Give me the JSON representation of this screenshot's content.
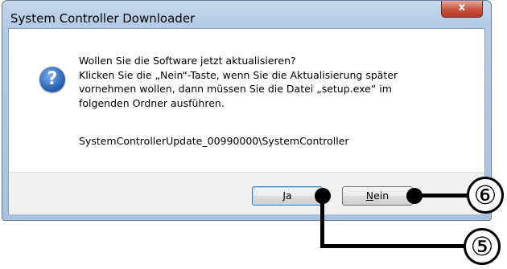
{
  "window": {
    "title": "System Controller Downloader",
    "close_label": "x"
  },
  "dialog": {
    "icon": "question-icon",
    "icon_glyph": "?",
    "message_lines": [
      "Wollen Sie die Software jetzt aktualisieren?",
      "Klicken  Sie die „Nein“-Taste, wenn Sie die Aktualisierung später",
      "vornehmen wollen, dann müssen Sie die Datei „setup.exe“ im",
      "folgenden Ordner ausführen."
    ],
    "path": "SystemControllerUpdate_00990000\\SystemController"
  },
  "buttons": {
    "ja": "Ja",
    "nein_underlined": "N",
    "nein_rest": "ein"
  },
  "callouts": {
    "nein_marker": "⑥",
    "ja_marker": "⑤"
  }
}
